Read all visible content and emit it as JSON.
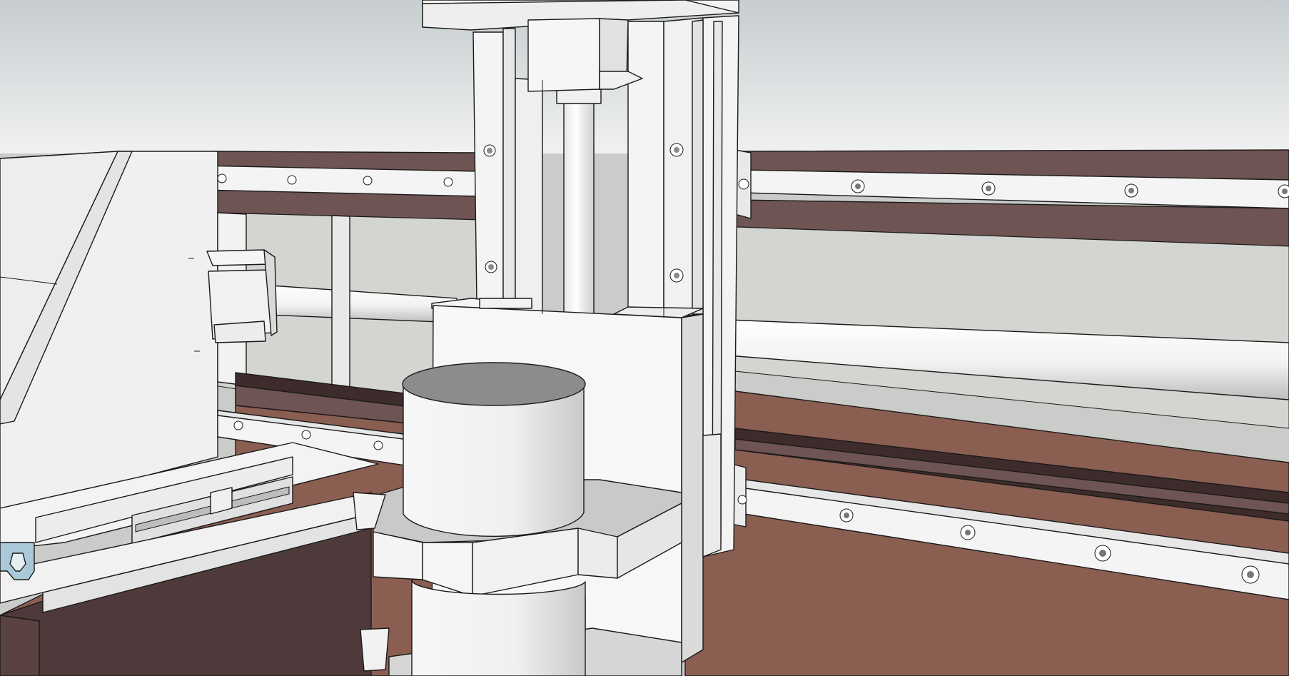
{
  "viewport": {
    "title": ""
  },
  "colors": {
    "sky_top": "#c9cfd1",
    "sky_bottom": "#eef0ef",
    "ground": "#c9ccc8",
    "panel": "#f2f2f2",
    "panel_shade": "#e2e2e2",
    "panel_dark": "#cfcfcf",
    "gantry_side": "#6e5452",
    "gantry_dark": "#3d2c2b",
    "bed_wood": "#8b5e52",
    "bed_shadow": "#4a3535",
    "frame_dark": "#4e3a3a",
    "cylinder_top": "#8c8c8c",
    "cylinder_shade": "#d9d9d9",
    "linear_guide_tint": "#a9c8d8"
  },
  "model_parts": [
    "left-side-plate",
    "gantry-beam",
    "top-linear-rail",
    "bottom-linear-rail",
    "x-axis-ball-screw",
    "z-axis-column",
    "z-axis-motor-mount",
    "z-axis-lead-screw",
    "spindle-carriage",
    "spindle-cylinder",
    "spindle-clamp",
    "machine-bed",
    "y-axis-linear-guide"
  ]
}
